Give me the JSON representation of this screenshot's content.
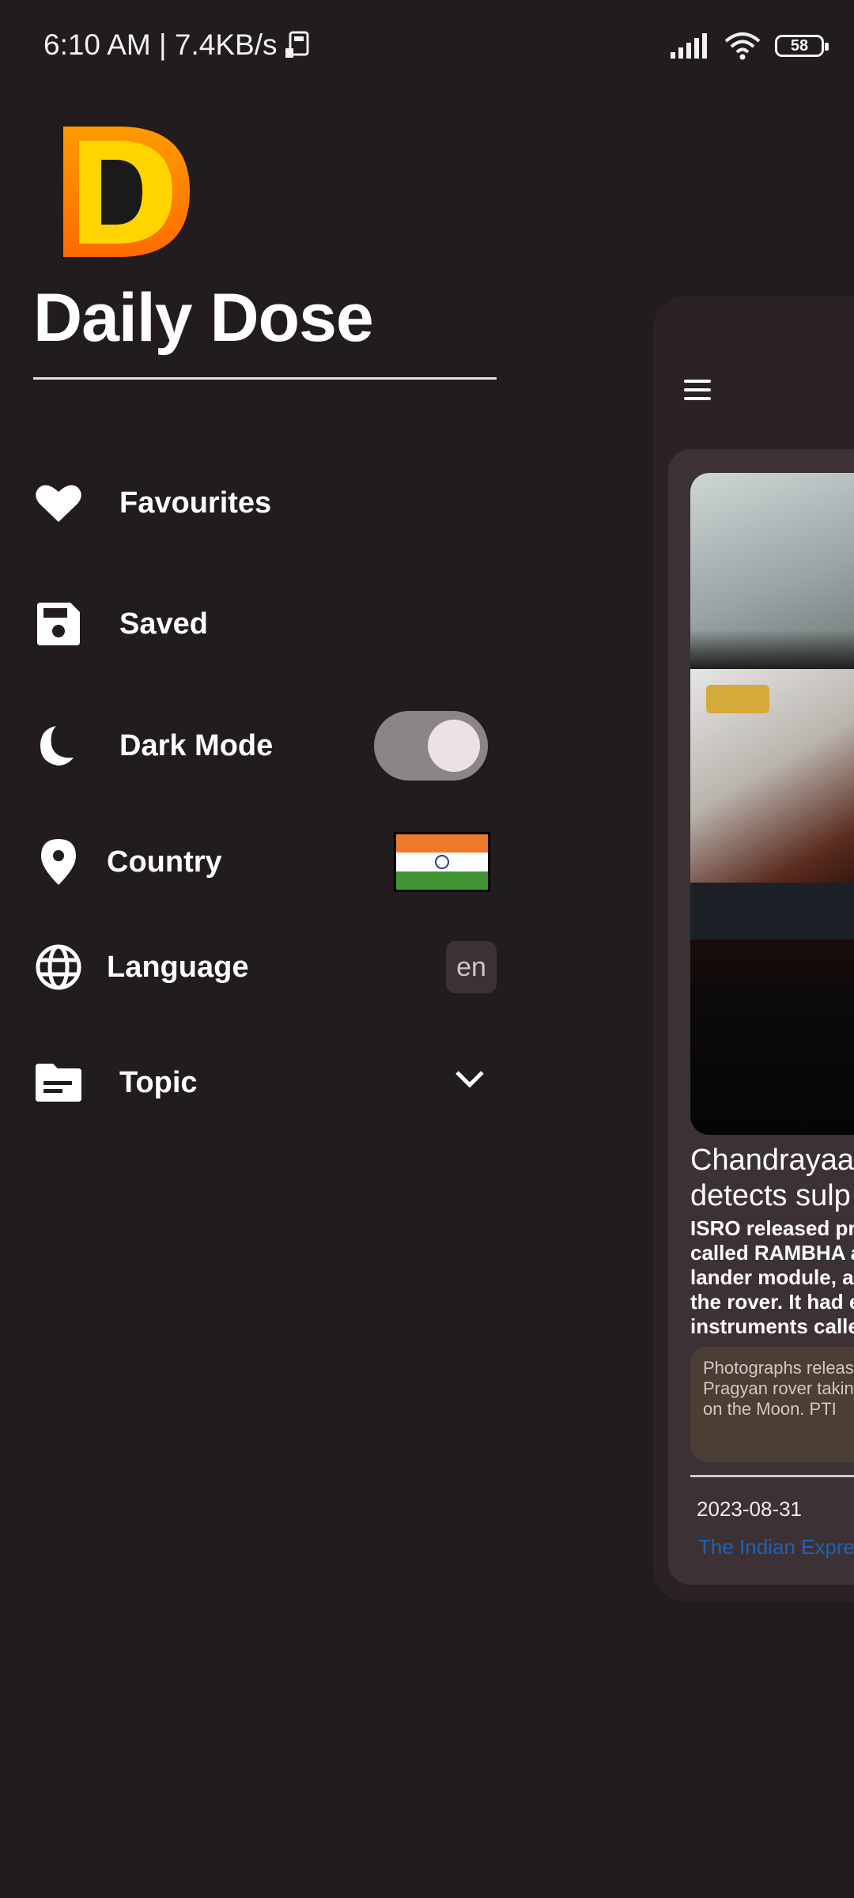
{
  "status_bar": {
    "time_net": "6:10 AM | 7.4KB/s",
    "battery": "58"
  },
  "drawer": {
    "app_title": "Daily Dose",
    "logo_letter": "D",
    "items": [
      {
        "label": "Favourites",
        "icon": "heart-icon"
      },
      {
        "label": "Saved",
        "icon": "floppy-disk-icon"
      },
      {
        "label": "Dark Mode",
        "icon": "moon-icon",
        "toggle_on": true
      },
      {
        "label": "Country",
        "icon": "location-pin-icon",
        "flag": "india-flag"
      },
      {
        "label": "Language",
        "icon": "globe-icon",
        "value": "en"
      },
      {
        "label": "Topic",
        "icon": "topic-icon",
        "dropdown": "chevron-down-icon"
      }
    ]
  },
  "article": {
    "headline_line1": "Chandrayaa",
    "headline_line2": "detects sulp",
    "body_lines": [
      "ISRO released pre",
      "called RAMBHA a",
      "lander module, an",
      "the rover. It had e",
      "instruments calle"
    ],
    "caption_lines": [
      "Photographs releas",
      "Pragyan rover takin",
      "on the Moon. PTI"
    ],
    "date": "2023-08-31",
    "source": "The Indian Expre"
  },
  "colors": {
    "background": "#231c1e",
    "card": "#3c3235",
    "link": "#1e62b5"
  }
}
